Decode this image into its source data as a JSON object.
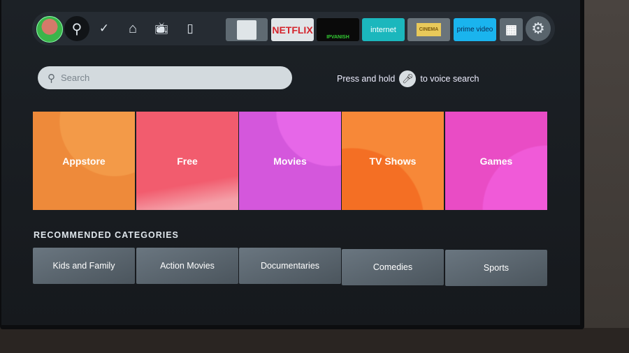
{
  "topbar": {
    "nav": [
      {
        "icon": "profile-avatar"
      },
      {
        "icon": "search-icon"
      },
      {
        "icon": "check-circle-icon"
      },
      {
        "icon": "home-icon"
      },
      {
        "icon": "live-tv-icon"
      },
      {
        "icon": "bookmark-icon"
      }
    ],
    "apps": [
      {
        "label": "",
        "color": "#dfe5e8"
      },
      {
        "label": "NETFLIX",
        "color": "#e1e5e8"
      },
      {
        "label": "IPVANISH",
        "color": "#0a0a0a"
      },
      {
        "label": "internet",
        "color": "#1bb7bd"
      },
      {
        "label": "CINEMA",
        "color": "#d8d2c8"
      },
      {
        "label": "prime video",
        "color": "#1ab4ee"
      }
    ],
    "apps_button_icon": "apps-grid-plus-icon",
    "settings_icon": "gear-icon"
  },
  "search": {
    "placeholder": "Search"
  },
  "voice_hint": {
    "before": "Press and hold",
    "after": "to voice search"
  },
  "tiles": [
    {
      "label": "Appstore",
      "color": "#f0913f"
    },
    {
      "label": "Free",
      "color": "#f2607a"
    },
    {
      "label": "Movies",
      "color": "#d95bdf"
    },
    {
      "label": "TV Shows",
      "color": "#f57a2d"
    },
    {
      "label": "Games",
      "color": "#ee56cf"
    }
  ],
  "recommended": {
    "title": "RECOMMENDED CATEGORIES",
    "items": [
      "Kids and Family",
      "Action Movies",
      "Documentaries",
      "Comedies",
      "Sports"
    ]
  }
}
